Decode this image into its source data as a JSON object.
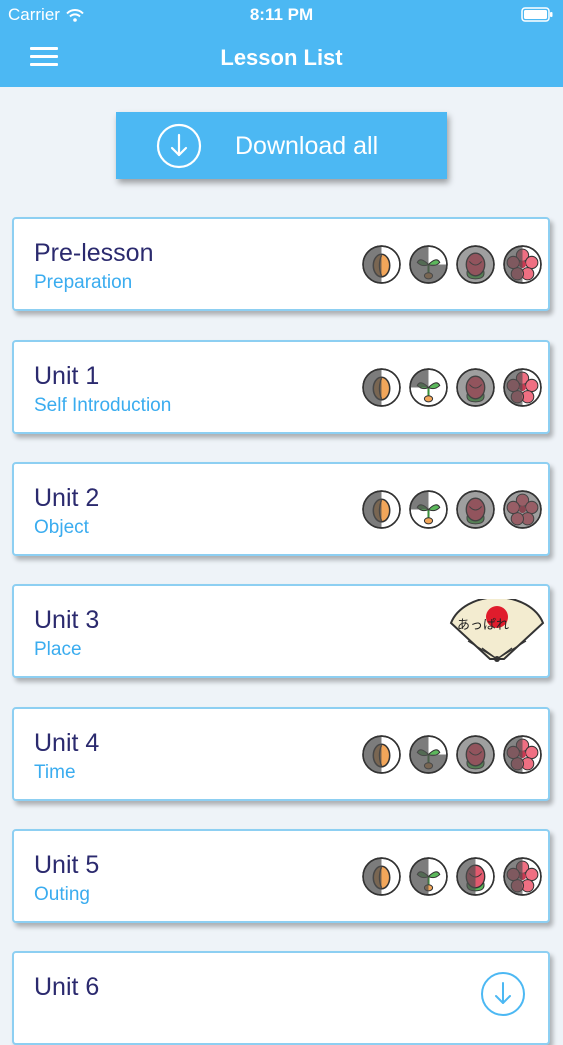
{
  "status": {
    "carrier": "Carrier",
    "time": "8:11 PM"
  },
  "nav": {
    "title": "Lesson List"
  },
  "download_all": {
    "label": "Download all"
  },
  "lessons": [
    {
      "unit": "Pre-lesson",
      "subtitle": "Preparation",
      "progress": "badges"
    },
    {
      "unit": "Unit 1",
      "subtitle": "Self Introduction",
      "progress": "badges"
    },
    {
      "unit": "Unit 2",
      "subtitle": "Object",
      "progress": "badges"
    },
    {
      "unit": "Unit 3",
      "subtitle": "Place",
      "progress": "fan"
    },
    {
      "unit": "Unit 4",
      "subtitle": "Time",
      "progress": "badges"
    },
    {
      "unit": "Unit 5",
      "subtitle": "Outing",
      "progress": "badges"
    },
    {
      "unit": "Unit 6",
      "subtitle": "",
      "progress": "download"
    }
  ],
  "badge_names": [
    "seed-badge-icon",
    "sprout-badge-icon",
    "bud-badge-icon",
    "blossom-badge-icon"
  ],
  "fan_text": "あっぱれ",
  "colors": {
    "accent": "#4cb8f3",
    "title_text": "#2b2a6e",
    "subtitle_text": "#3aacef",
    "card_border": "#8dcff2"
  }
}
